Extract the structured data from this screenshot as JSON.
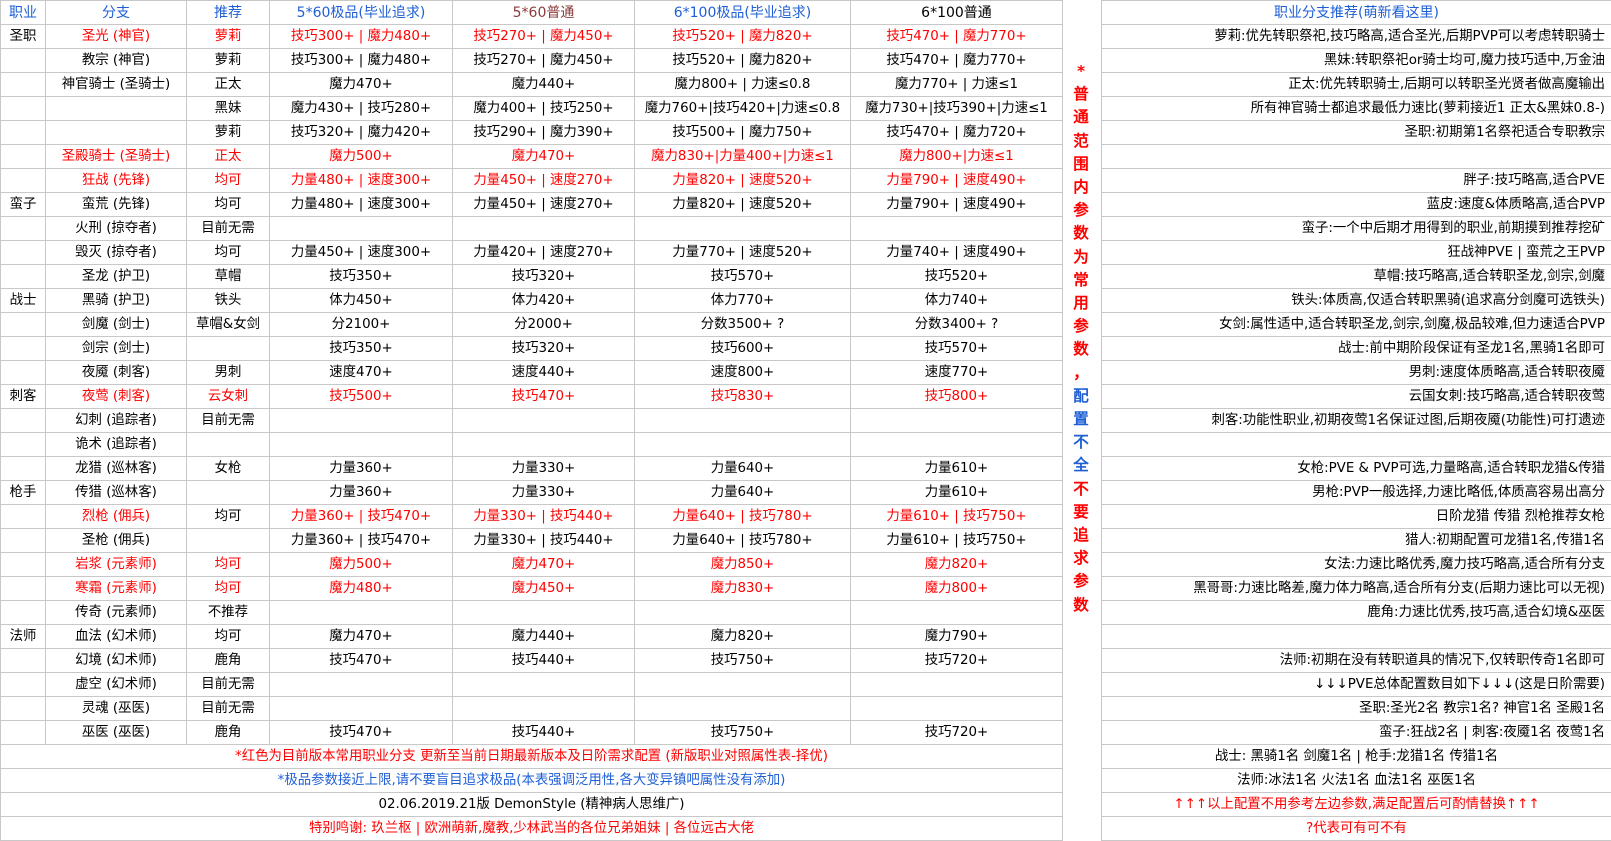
{
  "headers": [
    "职业",
    "分支",
    "推荐",
    "5*60极品(毕业追求)",
    "5*60普通",
    "6*100极品(毕业追求)",
    "6*100普通",
    "",
    "职业分支推荐(萌新看这里)"
  ],
  "rows": [
    [
      "圣职",
      "圣光 (神官)",
      "萝莉",
      "技巧300+ | 魔力480+",
      "技巧270+ | 魔力450+",
      "技巧520+ | 魔力820+",
      "技巧470+ | 魔力770+",
      "萝莉:优先转职祭祀,技巧略高,适合圣光,后期PVP可以考虑转职骑士"
    ],
    [
      "",
      "教宗 (神官)",
      "萝莉",
      "技巧300+ | 魔力480+",
      "技巧270+ | 魔力450+",
      "技巧520+ | 魔力820+",
      "技巧470+ | 魔力770+",
      "黑妹:转职祭祀or骑士均可,魔力技巧适中,万金油"
    ],
    [
      "",
      "神官骑士 (圣骑士)",
      "正太",
      "魔力470+",
      "魔力440+",
      "魔力800+ | 力速≤0.8",
      "魔力770+ | 力速≤1",
      "正太:优先转职骑士,后期可以转职圣光贤者做高魔输出"
    ],
    [
      "",
      "",
      "黑妹",
      "魔力430+ | 技巧280+",
      "魔力400+ | 技巧250+",
      "魔力760+|技巧420+|力速≤0.8",
      "魔力730+|技巧390+|力速≤1",
      "所有神官骑士都追求最低力速比(萝莉接近1 正太&黑妹0.8-)"
    ],
    [
      "",
      "",
      "萝莉",
      "技巧320+ | 魔力420+",
      "技巧290+ | 魔力390+",
      "技巧500+ | 魔力750+",
      "技巧470+ | 魔力720+",
      "圣职:初期第1名祭祀适合专职教宗"
    ],
    [
      "",
      "圣殿骑士 (圣骑士)",
      "正太",
      "魔力500+",
      "魔力470+",
      "魔力830+|力量400+|力速≤1",
      "魔力800+|力速≤1",
      ""
    ],
    [
      "",
      "狂战 (先锋)",
      "均可",
      "力量480+ | 速度300+",
      "力量450+ | 速度270+",
      "力量820+ | 速度520+",
      "力量790+ | 速度490+",
      "胖子:技巧略高,适合PVE"
    ],
    [
      "蛮子",
      "蛮荒 (先锋)",
      "均可",
      "力量480+ | 速度300+",
      "力量450+ | 速度270+",
      "力量820+ | 速度520+",
      "力量790+ | 速度490+",
      "蓝皮:速度&体质略高,适合PVP"
    ],
    [
      "",
      "火刑 (掠夺者)",
      "目前无需",
      "",
      "",
      "",
      "",
      "蛮子:一个中后期才用得到的职业,前期摸到推荐挖矿"
    ],
    [
      "",
      "毁灭 (掠夺者)",
      "均可",
      "力量450+ | 速度300+",
      "力量420+ | 速度270+",
      "力量770+ | 速度520+",
      "力量740+ | 速度490+",
      "狂战神PVE | 蛮荒之王PVP"
    ],
    [
      "",
      "圣龙 (护卫)",
      "草帽",
      "技巧350+",
      "技巧320+",
      "技巧570+",
      "技巧520+",
      "草帽:技巧略高,适合转职圣龙,剑宗,剑魔"
    ],
    [
      "战士",
      "黑骑 (护卫)",
      "铁头",
      "体力450+",
      "体力420+",
      "体力770+",
      "体力740+",
      "铁头:体质高,仅适合转职黑骑(追求高分剑魔可选铁头)"
    ],
    [
      "",
      "剑魔 (剑士)",
      "草帽&女剑",
      "分2100+",
      "分2000+",
      "分数3500+ ?",
      "分数3400+ ?",
      "女剑:属性适中,适合转职圣龙,剑宗,剑魔,极品较难,但力速适合PVP"
    ],
    [
      "",
      "剑宗 (剑士)",
      "",
      "技巧350+",
      "技巧320+",
      "技巧600+",
      "技巧570+",
      "战士:前中期阶段保证有圣龙1名,黑骑1名即可"
    ],
    [
      "",
      "夜魇 (刺客)",
      "男刺",
      "速度470+",
      "速度440+",
      "速度800+",
      "速度770+",
      "男刺:速度体质略高,适合转职夜魇"
    ],
    [
      "刺客",
      "夜莺 (刺客)",
      "云女刺",
      "技巧500+",
      "技巧470+",
      "技巧830+",
      "技巧800+",
      "云国女刺:技巧略高,适合转职夜莺"
    ],
    [
      "",
      "幻刺 (追踪者)",
      "目前无需",
      "",
      "",
      "",
      "",
      "刺客:功能性职业,初期夜莺1名保证过图,后期夜魇(功能性)可打遗迹"
    ],
    [
      "",
      "诡术 (追踪者)",
      "",
      "",
      "",
      "",
      "",
      ""
    ],
    [
      "",
      "龙猎 (巡林客)",
      "女枪",
      "力量360+",
      "力量330+",
      "力量640+",
      "力量610+",
      "女枪:PVE & PVP可选,力量略高,适合转职龙猎&传猎"
    ],
    [
      "枪手",
      "传猎 (巡林客)",
      "",
      "力量360+",
      "力量330+",
      "力量640+",
      "力量610+",
      "男枪:PVP一般选择,力速比略低,体质高容易出高分"
    ],
    [
      "",
      "烈枪 (佣兵)",
      "均可",
      "力量360+ | 技巧470+",
      "力量330+ | 技巧440+",
      "力量640+ | 技巧780+",
      "力量610+ | 技巧750+",
      "日阶龙猎 传猎 烈枪推荐女枪"
    ],
    [
      "",
      "圣枪 (佣兵)",
      "",
      "力量360+ | 技巧470+",
      "力量330+ | 技巧440+",
      "力量640+ | 技巧780+",
      "力量610+ | 技巧750+",
      "猎人:初期配置可龙猎1名,传猎1名"
    ],
    [
      "",
      "岩浆 (元素师)",
      "均可",
      "魔力500+",
      "魔力470+",
      "魔力850+",
      "魔力820+",
      "女法:力速比略优秀,魔力技巧略高,适合所有分支"
    ],
    [
      "",
      "寒霜 (元素师)",
      "均可",
      "魔力480+",
      "魔力450+",
      "魔力830+",
      "魔力800+",
      "黑哥哥:力速比略差,魔力体力略高,适合所有分支(后期力速比可以无视)"
    ],
    [
      "",
      "传奇 (元素师)",
      "不推荐",
      "",
      "",
      "",
      "",
      "鹿角:力速比优秀,技巧高,适合幻境&巫医"
    ],
    [
      "法师",
      "血法 (幻术师)",
      "均可",
      "魔力470+",
      "魔力440+",
      "魔力820+",
      "魔力790+",
      ""
    ],
    [
      "",
      "幻境 (幻术师)",
      "鹿角",
      "技巧470+",
      "技巧440+",
      "技巧750+",
      "技巧720+",
      "法师:初期在没有转职道具的情况下,仅转职传奇1名即可"
    ],
    [
      "",
      "虚空 (幻术师)",
      "目前无需",
      "",
      "",
      "",
      "",
      "↓↓↓PVE总体配置数目如下↓↓↓(这是日阶需要)"
    ],
    [
      "",
      "灵魂 (巫医)",
      "目前无需",
      "",
      "",
      "",
      "",
      "圣职:圣光2名 教宗1名? 神官1名 圣殿1名"
    ],
    [
      "",
      "巫医 (巫医)",
      "鹿角",
      "技巧470+",
      "技巧440+",
      "技巧750+",
      "技巧720+",
      "蛮子:狂战2名 | 刺客:夜魇1名 夜莺1名"
    ]
  ],
  "footer_rows": [
    [
      "*红色为目前版本常用职业分支 更新至当前日期最新版本及日阶需求配置    (新版职业对照属性表-择优)",
      "战士: 黑骑1名 剑魔1名  | 枪手:龙猎1名 传猎1名"
    ],
    [
      "*极品参数接近上限,请不要盲目追求极品(本表强调泛用性,各大变异镇吧属性没有添加)",
      "法师:冰法1名 火法1名 血法1名 巫医1名"
    ],
    [
      "02.06.2019.21版  DemonStyle (精神病人思维广)",
      "↑↑↑以上配置不用参考左边参数,满足配置后可酌情替换↑↑↑"
    ],
    [
      "特别鸣谢:       玖兰枢 | 欧洲萌新,魔教,少林武当的各位兄弟姐妹 | 各位远古大佬",
      "?代表可有可不有"
    ]
  ],
  "vertical_note_red": [
    "*",
    "普",
    "通",
    "范",
    "围",
    "内",
    "参",
    "数",
    "为",
    "常",
    "用",
    "参",
    "数",
    "，"
  ],
  "vertical_note_blue": [
    "配",
    "置",
    "不",
    "全"
  ],
  "vertical_note_red2": [
    "不",
    "要",
    "追",
    "求",
    "参",
    "数"
  ],
  "colors": {
    "red": "#ff0000",
    "blue": "#1f5fd6",
    "brown": "#8b3a3a",
    "green": "#2e8b57"
  }
}
